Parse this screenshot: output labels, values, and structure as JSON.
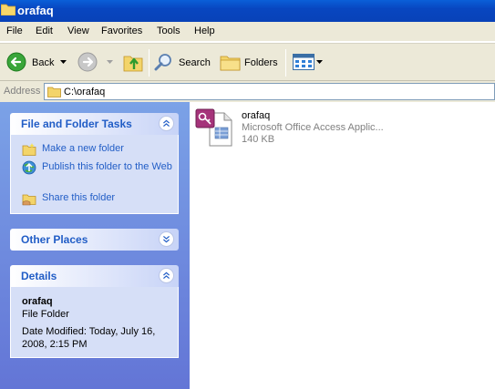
{
  "window": {
    "title": "orafaq"
  },
  "menu": [
    "File",
    "Edit",
    "View",
    "Favorites",
    "Tools",
    "Help"
  ],
  "toolbar": {
    "back_label": "Back",
    "search_label": "Search",
    "folders_label": "Folders"
  },
  "address": {
    "label": "Address",
    "value": "C:\\orafaq"
  },
  "tasks_panel": {
    "title": "File and Folder Tasks",
    "items": [
      {
        "label": "Make a new folder",
        "icon": "new-folder-icon"
      },
      {
        "label": "Publish this folder to the Web",
        "icon": "publish-web-icon"
      },
      {
        "label": "Share this folder",
        "icon": "share-folder-icon"
      }
    ]
  },
  "other_places": {
    "title": "Other Places"
  },
  "details": {
    "title": "Details",
    "name": "orafaq",
    "type": "File Folder",
    "modified": "Date Modified: Today, July 16, 2008, 2:15 PM"
  },
  "files": [
    {
      "name": "orafaq",
      "type": "Microsoft Office Access Applic...",
      "size": "140 KB",
      "icon": "access-application-icon"
    }
  ]
}
